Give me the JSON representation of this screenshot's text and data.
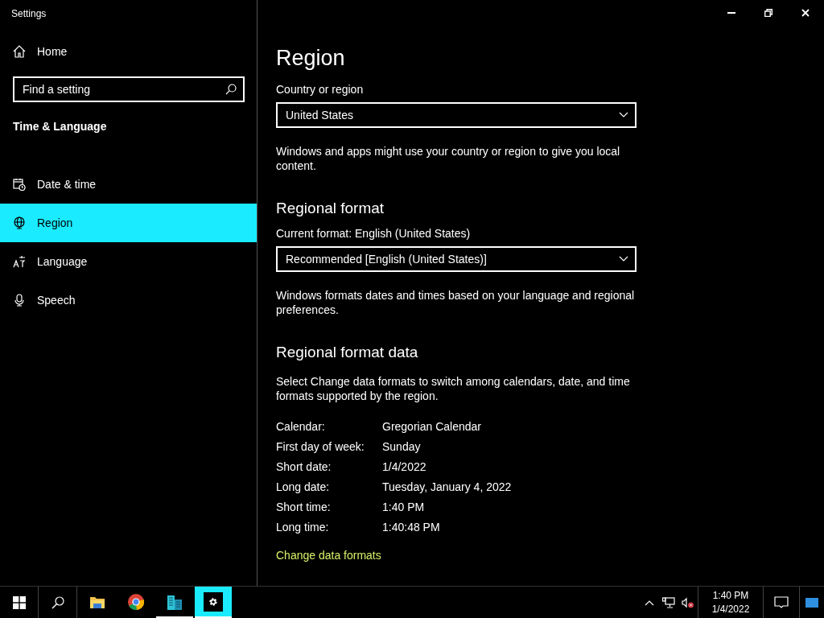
{
  "window": {
    "title": "Settings"
  },
  "sidebar": {
    "home": "Home",
    "search": {
      "placeholder": "Find a setting"
    },
    "section_title": "Time & Language",
    "items": [
      {
        "kind": "calendar",
        "label": "Date & time",
        "selected": false
      },
      {
        "kind": "globe",
        "label": "Region",
        "selected": true
      },
      {
        "kind": "language",
        "label": "Language",
        "selected": false
      },
      {
        "kind": "microphone",
        "label": "Speech",
        "selected": false
      }
    ]
  },
  "main": {
    "title": "Region",
    "sections": [
      {
        "kind": "dropdown",
        "label": "Country or region",
        "value": "United States",
        "note": "Windows and apps might use your country or region to give you local content."
      },
      {
        "kind": "dropdown",
        "heading": "Regional format",
        "label": "Current format: English (United States)",
        "value": "Recommended [English (United States)]",
        "note": "Windows formats dates and times based on your language and regional preferences."
      },
      {
        "kind": "data",
        "heading": "Regional format data",
        "note": "Select Change data formats to switch among calendars, date, and time formats supported by the region.",
        "rows": [
          {
            "label": "Calendar:",
            "value": "Gregorian Calendar"
          },
          {
            "label": "First day of week:",
            "value": "Sunday"
          },
          {
            "label": "Short date:",
            "value": "1/4/2022"
          },
          {
            "label": "Long date:",
            "value": "Tuesday, January 4, 2022"
          },
          {
            "label": "Short time:",
            "value": "1:40 PM"
          },
          {
            "label": "Long time:",
            "value": "1:40:48 PM"
          }
        ],
        "link": "Change data formats"
      }
    ]
  },
  "taskbar": {
    "apps": [
      {
        "kind": "folder",
        "running": false,
        "active": false
      },
      {
        "kind": "browser",
        "running": false,
        "active": false
      },
      {
        "kind": "buildings",
        "running": true,
        "active": false
      },
      {
        "kind": "gear",
        "running": true,
        "active": true
      }
    ],
    "time": "1:40 PM",
    "date": "1/4/2022"
  }
}
